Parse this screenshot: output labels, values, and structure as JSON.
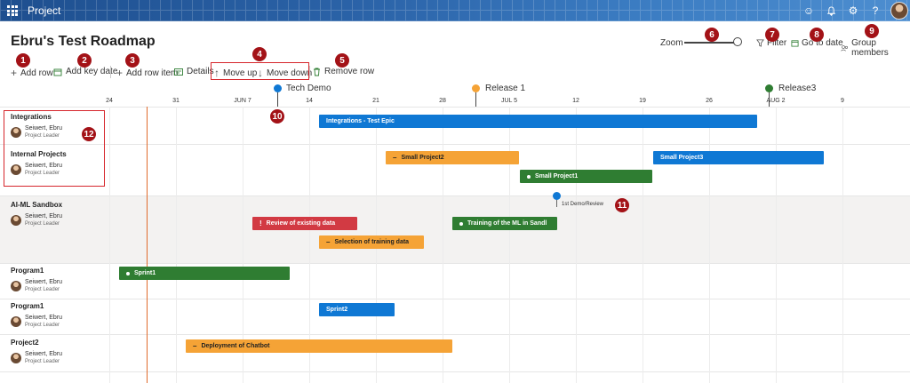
{
  "header": {
    "app_name": "Project"
  },
  "page": {
    "title": "Ebru's Test Roadmap"
  },
  "zoom": {
    "label": "Zoom"
  },
  "top_actions": {
    "filter": "Filter",
    "go_to_date": "Go to date",
    "group_members": "Group members"
  },
  "toolbar": {
    "add_row": "Add row",
    "add_key_date": "Add key date",
    "add_row_item": "Add row item",
    "details": "Details",
    "move_up": "Move up",
    "move_down": "Move down",
    "remove_row": "Remove row"
  },
  "callouts": [
    "1",
    "2",
    "3",
    "4",
    "5",
    "6",
    "7",
    "8",
    "9",
    "10",
    "11",
    "12"
  ],
  "timeline": {
    "ticks": [
      "24",
      "31",
      "JUN 7",
      "14",
      "21",
      "28",
      "JUL 5",
      "12",
      "19",
      "26",
      "AUG 2",
      "9"
    ]
  },
  "milestones": {
    "tech_demo": {
      "label": "Tech Demo",
      "color": "#0f78d4"
    },
    "release1": {
      "label": "Release 1",
      "color": "#f5a336"
    },
    "release3": {
      "label": "Release3",
      "color": "#2f7d32"
    },
    "demo_review": {
      "label": "1st Demo/Review",
      "color": "#0f78d4"
    }
  },
  "owner": {
    "name": "Seiwert, Ebru",
    "role": "Project Leader"
  },
  "rows": [
    {
      "name": "Integrations"
    },
    {
      "name": "Internal Projects"
    },
    {
      "name": "AI-ML Sandbox"
    },
    {
      "name": "Program1"
    },
    {
      "name": "Program1"
    },
    {
      "name": "Project2"
    }
  ],
  "bars": {
    "integrations_test_epic": "Integrations - Test Epic",
    "small_project2": "Small Project2",
    "small_project3": "Small Project3",
    "small_project1": "Small Project1",
    "review_existing_data": "Review of existing data",
    "training_ml": "Training of the ML in Sandl",
    "selection_training_data": "Selection of training data",
    "sprint1": "Sprint1",
    "sprint2": "Sprint2",
    "deployment_chatbot": "Deployment of Chatbot"
  },
  "colors": {
    "accent_blue": "#0f78d4",
    "orange": "#f5a336",
    "green": "#2f7d32",
    "red": "#d23a43",
    "callout": "#a31217"
  }
}
